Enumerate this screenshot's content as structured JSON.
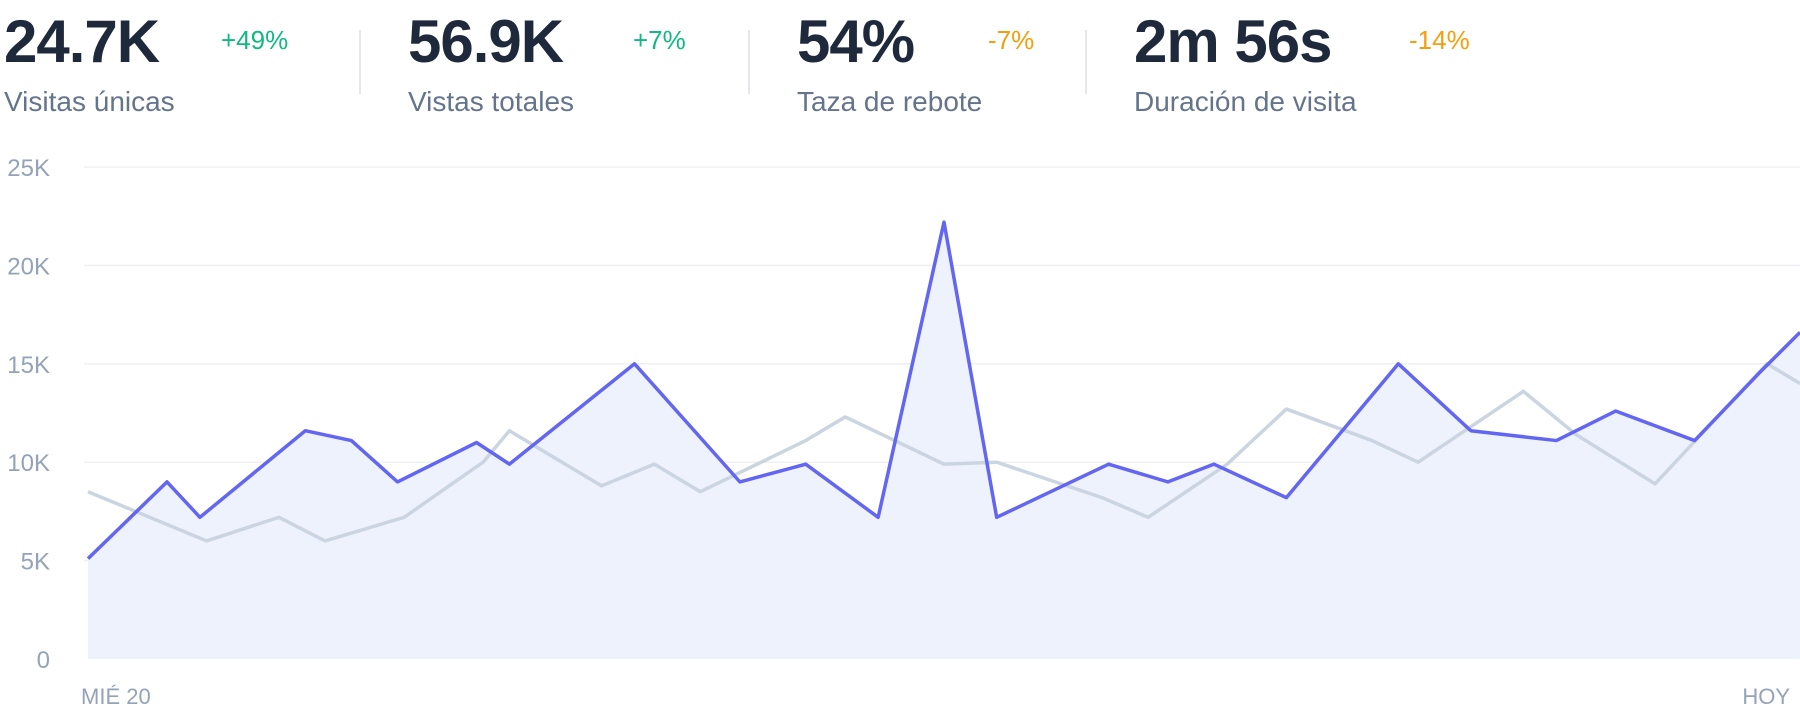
{
  "stats": [
    {
      "value": "24.7K",
      "change": "+49%",
      "change_color": "#10b981",
      "label": "Visitas únicas"
    },
    {
      "value": "56.9K",
      "change": "+7%",
      "change_color": "#10b981",
      "label": "Vistas totales"
    },
    {
      "value": "54%",
      "change": "-7%",
      "change_color": "#f59e0b",
      "label": "Taza de rebote"
    },
    {
      "value": "2m 56s",
      "change": "-14%",
      "change_color": "#f59e0b",
      "label": "Duración de visita"
    }
  ],
  "chart_data": {
    "type": "area",
    "title": "",
    "xlabel": "",
    "ylabel": "",
    "ylim": [
      0,
      25000
    ],
    "yticks": [
      0,
      5000,
      10000,
      15000,
      20000,
      25000
    ],
    "ytick_labels": [
      "0",
      "5K",
      "10K",
      "15K",
      "20K",
      "25K"
    ],
    "x_tick_labels": [
      "MIÉ 20",
      "HOY"
    ],
    "grid": true,
    "colors": {
      "current": "#6366f1",
      "previous": "#cbd5e1",
      "fill": "#eef2fc",
      "grid": "#eef0f4",
      "axis_text": "#94a3b8"
    },
    "series": [
      {
        "values": [
          [
            0,
            5100
          ],
          [
            1.2,
            9000
          ],
          [
            1.7,
            7200
          ],
          [
            3.3,
            11600
          ],
          [
            4.0,
            11100
          ],
          [
            4.7,
            9000
          ],
          [
            5.9,
            11000
          ],
          [
            6.4,
            9900
          ],
          [
            8.3,
            15000
          ],
          [
            9.9,
            9000
          ],
          [
            10.9,
            9900
          ],
          [
            12.0,
            7200
          ],
          [
            13.0,
            22200
          ],
          [
            13.8,
            7200
          ],
          [
            15.5,
            9900
          ],
          [
            16.4,
            9000
          ],
          [
            17.1,
            9900
          ],
          [
            18.2,
            8200
          ],
          [
            19.9,
            15000
          ],
          [
            21.0,
            11600
          ],
          [
            22.3,
            11100
          ],
          [
            23.2,
            12600
          ],
          [
            24.4,
            11100
          ],
          [
            25.4,
            14600
          ],
          [
            26.0,
            16600
          ]
        ]
      },
      {
        "values": [
          [
            0,
            8500
          ],
          [
            1.8,
            6000
          ],
          [
            2.9,
            7200
          ],
          [
            3.6,
            6000
          ],
          [
            4.8,
            7200
          ],
          [
            6.0,
            10000
          ],
          [
            6.4,
            11600
          ],
          [
            7.8,
            8800
          ],
          [
            8.6,
            9900
          ],
          [
            9.3,
            8500
          ],
          [
            10.9,
            11100
          ],
          [
            11.5,
            12300
          ],
          [
            13.0,
            9900
          ],
          [
            13.8,
            10000
          ],
          [
            15.4,
            8200
          ],
          [
            16.1,
            7200
          ],
          [
            17.3,
            9900
          ],
          [
            18.2,
            12700
          ],
          [
            19.5,
            11100
          ],
          [
            20.2,
            10000
          ],
          [
            21.8,
            13600
          ],
          [
            22.6,
            11400
          ],
          [
            23.8,
            8900
          ],
          [
            25.5,
            15000
          ],
          [
            26.0,
            14000
          ]
        ]
      }
    ]
  }
}
